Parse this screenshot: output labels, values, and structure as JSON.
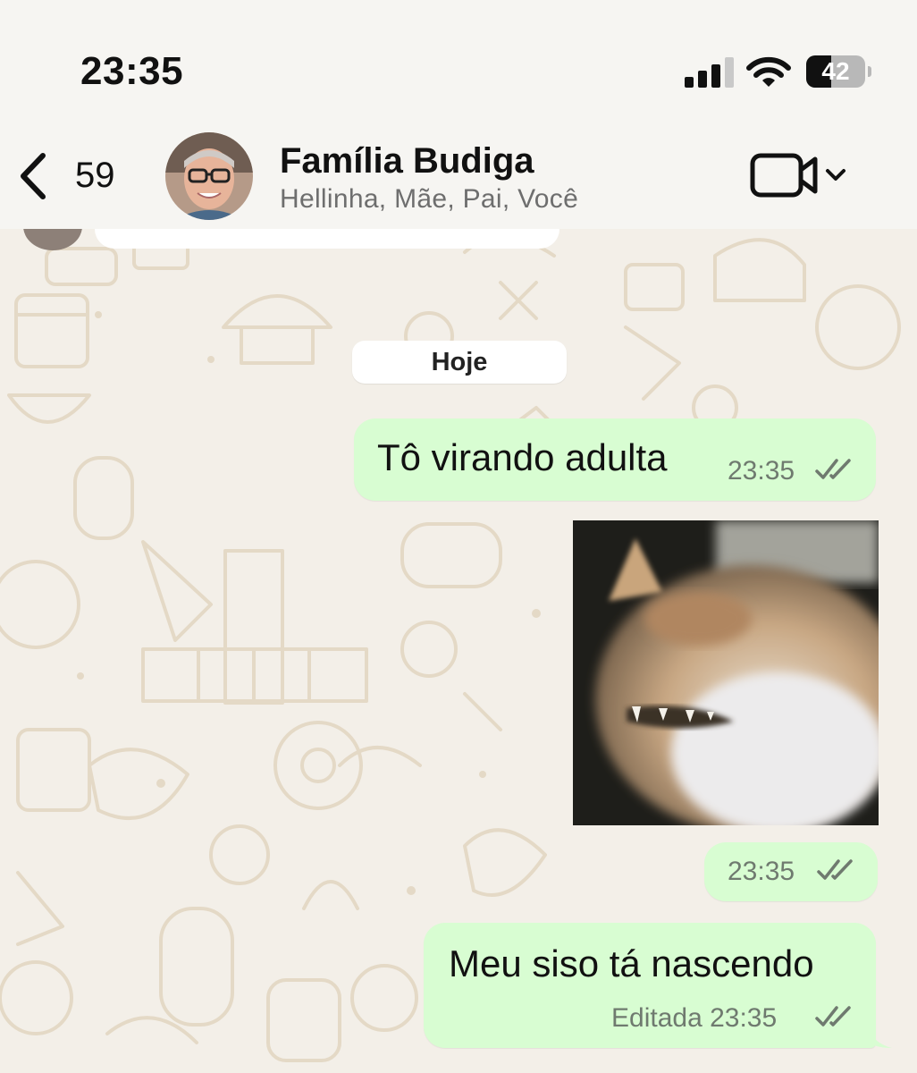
{
  "status_bar": {
    "time": "23:35",
    "battery_level": "42",
    "signal_bars_active": 3,
    "signal_bars_total": 4
  },
  "header": {
    "unread_count": "59",
    "group_name": "Família Budiga",
    "members": "Hellinha, Mãe, Pai, Você",
    "icons": [
      "chevron-left-icon",
      "video-camera-icon",
      "chevron-down-icon"
    ]
  },
  "chat": {
    "date_separator": "Hoje",
    "messages": [
      {
        "type": "text",
        "text": "Tô virando adulta",
        "time": "23:35",
        "status": "read"
      },
      {
        "type": "sticker",
        "description": "cat sticker",
        "time": "23:35",
        "status": "read"
      },
      {
        "type": "text",
        "text": "Meu siso tá nascendo",
        "edited_label": "Editada",
        "time": "23:35",
        "status": "read"
      }
    ]
  },
  "colors": {
    "outgoing_bubble": "#d8fdd2",
    "chat_background": "#f3efe8",
    "header_background": "#f6f5f2",
    "read_ticks": "#6f7a6f"
  }
}
